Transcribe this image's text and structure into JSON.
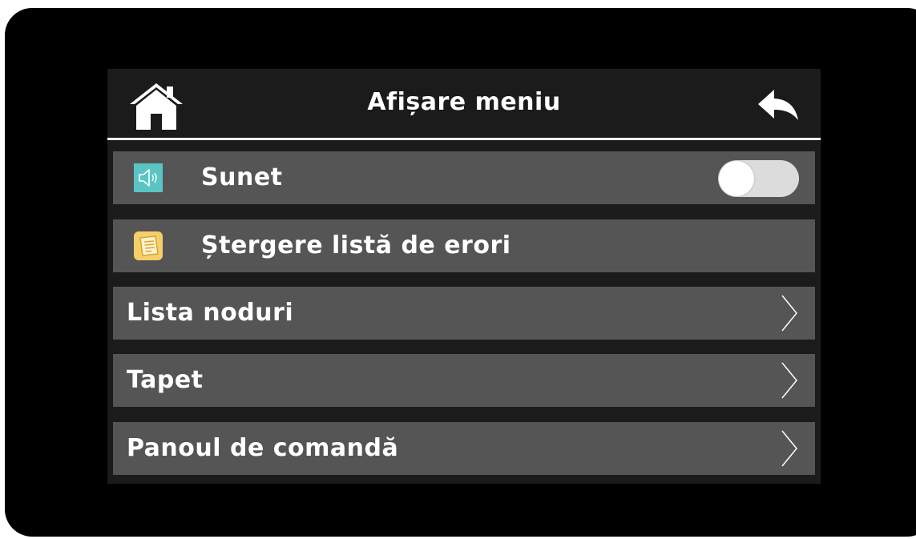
{
  "header": {
    "title": "Afișare meniu",
    "home_icon": "home-icon",
    "back_icon": "back-arrow-icon"
  },
  "menu": {
    "sound": {
      "label": "Sunet",
      "icon": "speaker-icon",
      "icon_color": "#5bc4c4",
      "toggle_on": false
    },
    "clear_errors": {
      "label": "Ștergere listă de erori",
      "icon": "notepad-icon",
      "icon_color": "#f5cf6a"
    },
    "node_list": {
      "label": "Lista noduri",
      "icon": "chevron-right-icon"
    },
    "wallpaper": {
      "label": "Tapet",
      "icon": "chevron-right-icon"
    },
    "control_panel": {
      "label": "Panoul de comandă",
      "icon": "chevron-right-icon"
    }
  },
  "colors": {
    "bezel": "#000000",
    "screen_bg": "#1b1b1b",
    "row_bg": "#555555",
    "text": "#ffffff",
    "toggle_track": "#dcdcdc"
  }
}
